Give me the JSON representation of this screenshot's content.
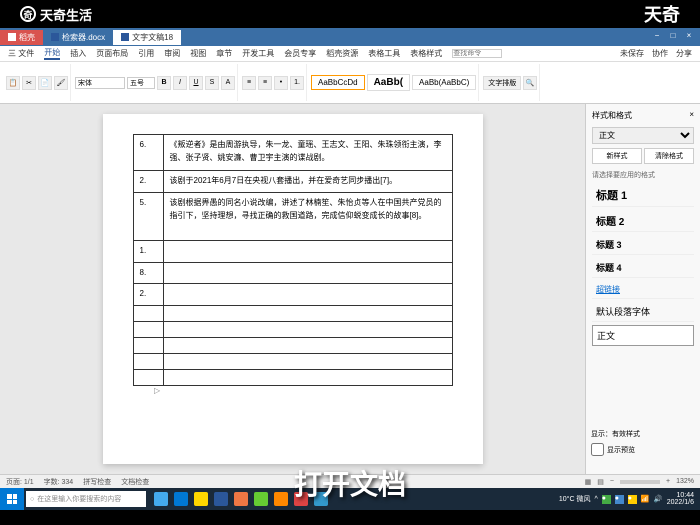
{
  "branding": {
    "logo_text": "天奇生活",
    "top_right": "天奇"
  },
  "caption": "打开文档",
  "tabs": [
    {
      "label": "稻壳"
    },
    {
      "label": "检索器.docx"
    },
    {
      "label": "文字文稿18"
    }
  ],
  "menu": {
    "items": [
      "三 文件",
      "开始",
      "插入",
      "页面布局",
      "引用",
      "审阅",
      "视图",
      "章节",
      "开发工具",
      "会员专享",
      "稻壳资源",
      "表格工具",
      "表格样式"
    ],
    "search_placeholder": "查找命令",
    "right": [
      "未保存",
      "协作",
      "分享"
    ]
  },
  "ribbon": {
    "font": "宋体",
    "size": "五号",
    "style_previews": [
      "AaBbCcDd",
      "AaBb(",
      "AaBb(AaBbC)"
    ],
    "style_labels": [
      "正文",
      "标题 1",
      "标题 2",
      "标题 3"
    ],
    "tools": "文字排版"
  },
  "table": {
    "rows": [
      {
        "num": "6.",
        "text": "《叛逆者》是由周游执导，朱一龙、童瑶、王志文、王阳、朱珠领衔主演，李强、张子贤、姚安濂、曹卫宇主演的谍战剧。"
      },
      {
        "num": "2.",
        "text": "该剧于2021年6月7日在央视八套播出，并在爱奇艺同步播出[7]。"
      },
      {
        "num": "5.",
        "text": "该剧根据畀愚的同名小说改编，讲述了林楠笙、朱怡贞等人在中国共产党员的指引下，坚持理想，寻找正确的救国道路，完成信仰蜕变成长的故事[8]。"
      },
      {
        "num": "1.",
        "text": ""
      },
      {
        "num": "8.",
        "text": ""
      },
      {
        "num": "2.",
        "text": ""
      },
      {
        "num": "",
        "text": ""
      },
      {
        "num": "",
        "text": ""
      },
      {
        "num": "",
        "text": ""
      },
      {
        "num": "",
        "text": ""
      },
      {
        "num": "",
        "text": ""
      }
    ]
  },
  "style_panel": {
    "title": "样式和格式",
    "current": "正文",
    "btn_new": "新样式",
    "btn_clear": "清除格式",
    "label": "请选择要应用的格式",
    "styles": [
      {
        "label": "标题 1",
        "cls": "h1"
      },
      {
        "label": "标题 2",
        "cls": "h2"
      },
      {
        "label": "标题 3",
        "cls": "h3"
      },
      {
        "label": "标题 4",
        "cls": "h3"
      },
      {
        "label": "超链接",
        "cls": "link"
      },
      {
        "label": "默认段落字体",
        "cls": ""
      },
      {
        "label": "正文",
        "cls": "normal"
      }
    ],
    "show_label": "显示：有效样式",
    "preview": "显示预览"
  },
  "status": {
    "page": "页面: 1/1",
    "words": "字数: 334",
    "spell": "拼写检查",
    "doc_check": "文档检查",
    "zoom": "132%"
  },
  "taskbar": {
    "search_placeholder": "在这里输入你要搜索的内容",
    "weather": "10°C 微风",
    "time": "10:44",
    "date": "2022/1/6"
  }
}
